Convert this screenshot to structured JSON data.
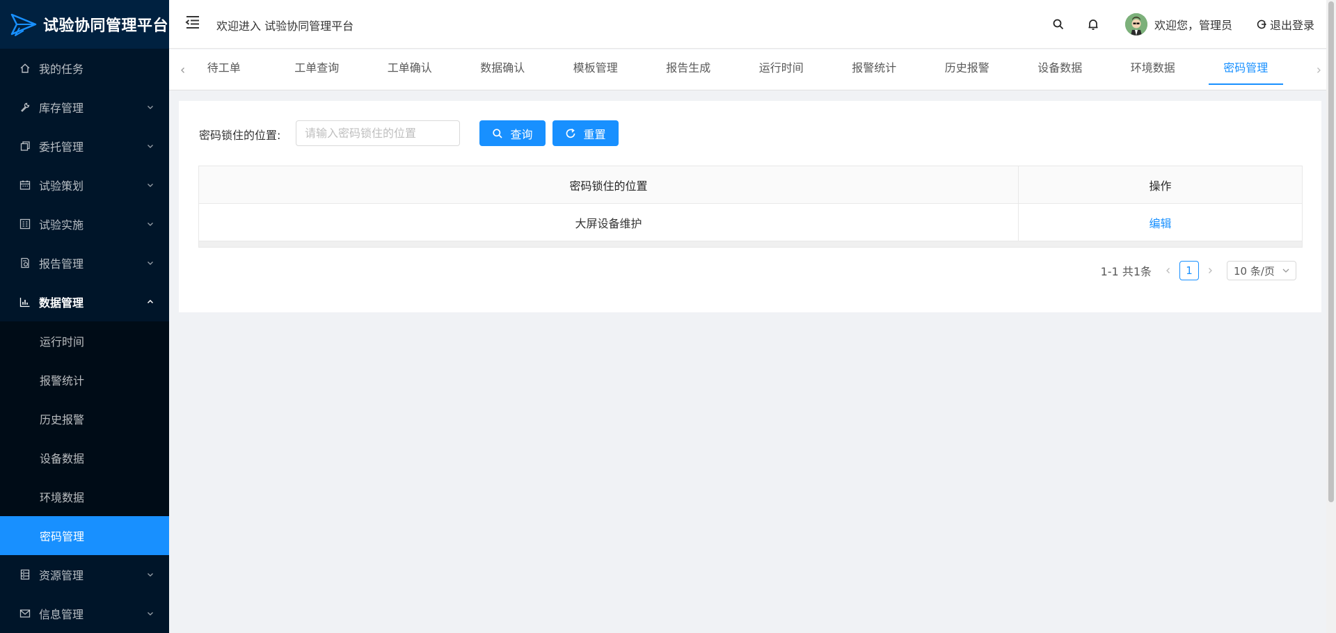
{
  "app": {
    "title": "试验协同管理平台"
  },
  "colors": {
    "primary": "#1890ff",
    "sidebar_bg": "#001529",
    "submenu_bg": "#000c17"
  },
  "sidebar": {
    "items": [
      {
        "label": "我的任务",
        "icon": "home-icon"
      },
      {
        "label": "库存管理",
        "icon": "wrench-icon"
      },
      {
        "label": "委托管理",
        "icon": "copy-icon"
      },
      {
        "label": "试验策划",
        "icon": "calendar-icon"
      },
      {
        "label": "试验实施",
        "icon": "grid-icon"
      },
      {
        "label": "报告管理",
        "icon": "report-icon"
      },
      {
        "label": "数据管理",
        "icon": "bar-chart-icon"
      }
    ],
    "sub_items": [
      "运行时间",
      "报警统计",
      "历史报警",
      "设备数据",
      "环境数据",
      "密码管理"
    ],
    "bottom_items": [
      {
        "label": "资源管理",
        "icon": "server-icon"
      },
      {
        "label": "信息管理",
        "icon": "mail-icon"
      }
    ]
  },
  "header": {
    "welcome": "欢迎进入 试验协同管理平台",
    "user_text": "欢迎您，管理员",
    "logout": "退出登录"
  },
  "tabs": [
    "待工单",
    "工单查询",
    "工单确认",
    "数据确认",
    "模板管理",
    "报告生成",
    "运行时间",
    "报警统计",
    "历史报警",
    "设备数据",
    "环境数据",
    "密码管理"
  ],
  "search": {
    "label": "密码锁住的位置:",
    "placeholder": "请输入密码锁住的位置",
    "value": "",
    "query_label": "查询",
    "reset_label": "重置"
  },
  "table": {
    "columns": [
      "密码锁住的位置",
      "操作"
    ],
    "rows": [
      {
        "location": "大屏设备维护",
        "action": "编辑"
      }
    ]
  },
  "pagination": {
    "total_text": "1-1 共1条",
    "current_page": "1",
    "page_size": "10 条/页"
  }
}
